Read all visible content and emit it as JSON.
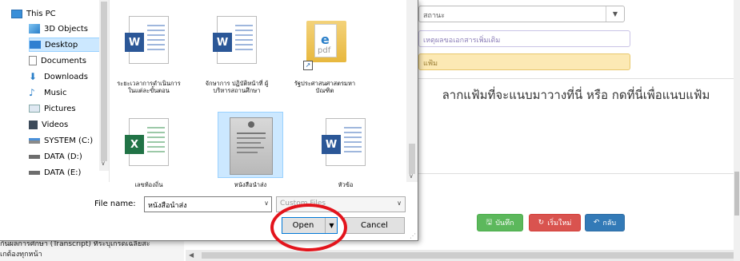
{
  "nav": {
    "items": [
      {
        "label": "This PC",
        "icon": "pc-icon"
      },
      {
        "label": "3D Objects",
        "icon": "cube-icon"
      },
      {
        "label": "Desktop",
        "icon": "desktop-icon"
      },
      {
        "label": "Documents",
        "icon": "documents-icon"
      },
      {
        "label": "Downloads",
        "icon": "downloads-icon"
      },
      {
        "label": "Music",
        "icon": "music-icon"
      },
      {
        "label": "Pictures",
        "icon": "pictures-icon"
      },
      {
        "label": "Videos",
        "icon": "videos-icon"
      },
      {
        "label": "SYSTEM (C:)",
        "icon": "drive-icon"
      },
      {
        "label": "DATA (D:)",
        "icon": "drive-icon"
      },
      {
        "label": "DATA (E:)",
        "icon": "drive-icon"
      }
    ]
  },
  "files": [
    {
      "label": "ระยะเวลาการดำเนินการในแต่ละขั้นตอน",
      "type": "word"
    },
    {
      "label": "จักษาการ ปฏิบัติหน้าที่ ผู้บริหารสถานศึกษา",
      "type": "word"
    },
    {
      "label": "รัฐประศาสนศาสตรมหาบัณฑิต",
      "type": "pdf-folder"
    },
    {
      "label": "เลขท้องถิ่น",
      "type": "excel"
    },
    {
      "label": "หนังสือนำส่ง",
      "type": "image",
      "selected": true
    },
    {
      "label": "หัวข้อ",
      "type": "word"
    }
  ],
  "dialog": {
    "filename_label": "File name:",
    "filename_value": "หนังสือนำส่ง",
    "filter_value": "Custom Files",
    "open_label": "Open",
    "cancel_label": "Cancel"
  },
  "page": {
    "status_placeholder": "สถานะ",
    "reason_placeholder": "เหตุผลขอเอกสารเพิ่มเติม",
    "file_placeholder": "แฟ้ม",
    "drop_text": "ลากแฟ้มที่จะแนบมาวางที่นี่ หรือ กดที่นี่เพื่อแนบแฟ้ม",
    "save_label": "บันทึก",
    "reset_label": "เริ่มใหม่",
    "back_label": "กลับ",
    "bottom_line1": "กันผลการศึกษา (Transcript) ที่ระบุเกรดเฉลี่ยสะ",
    "bottom_line2": "เกต้องทุกหน้า"
  },
  "colors": {
    "accent": "#0078d7",
    "selection": "#cce8ff",
    "save": "#5cb85c",
    "reset": "#d9534f",
    "back": "#337ab7",
    "annotation": "#e3141c"
  }
}
